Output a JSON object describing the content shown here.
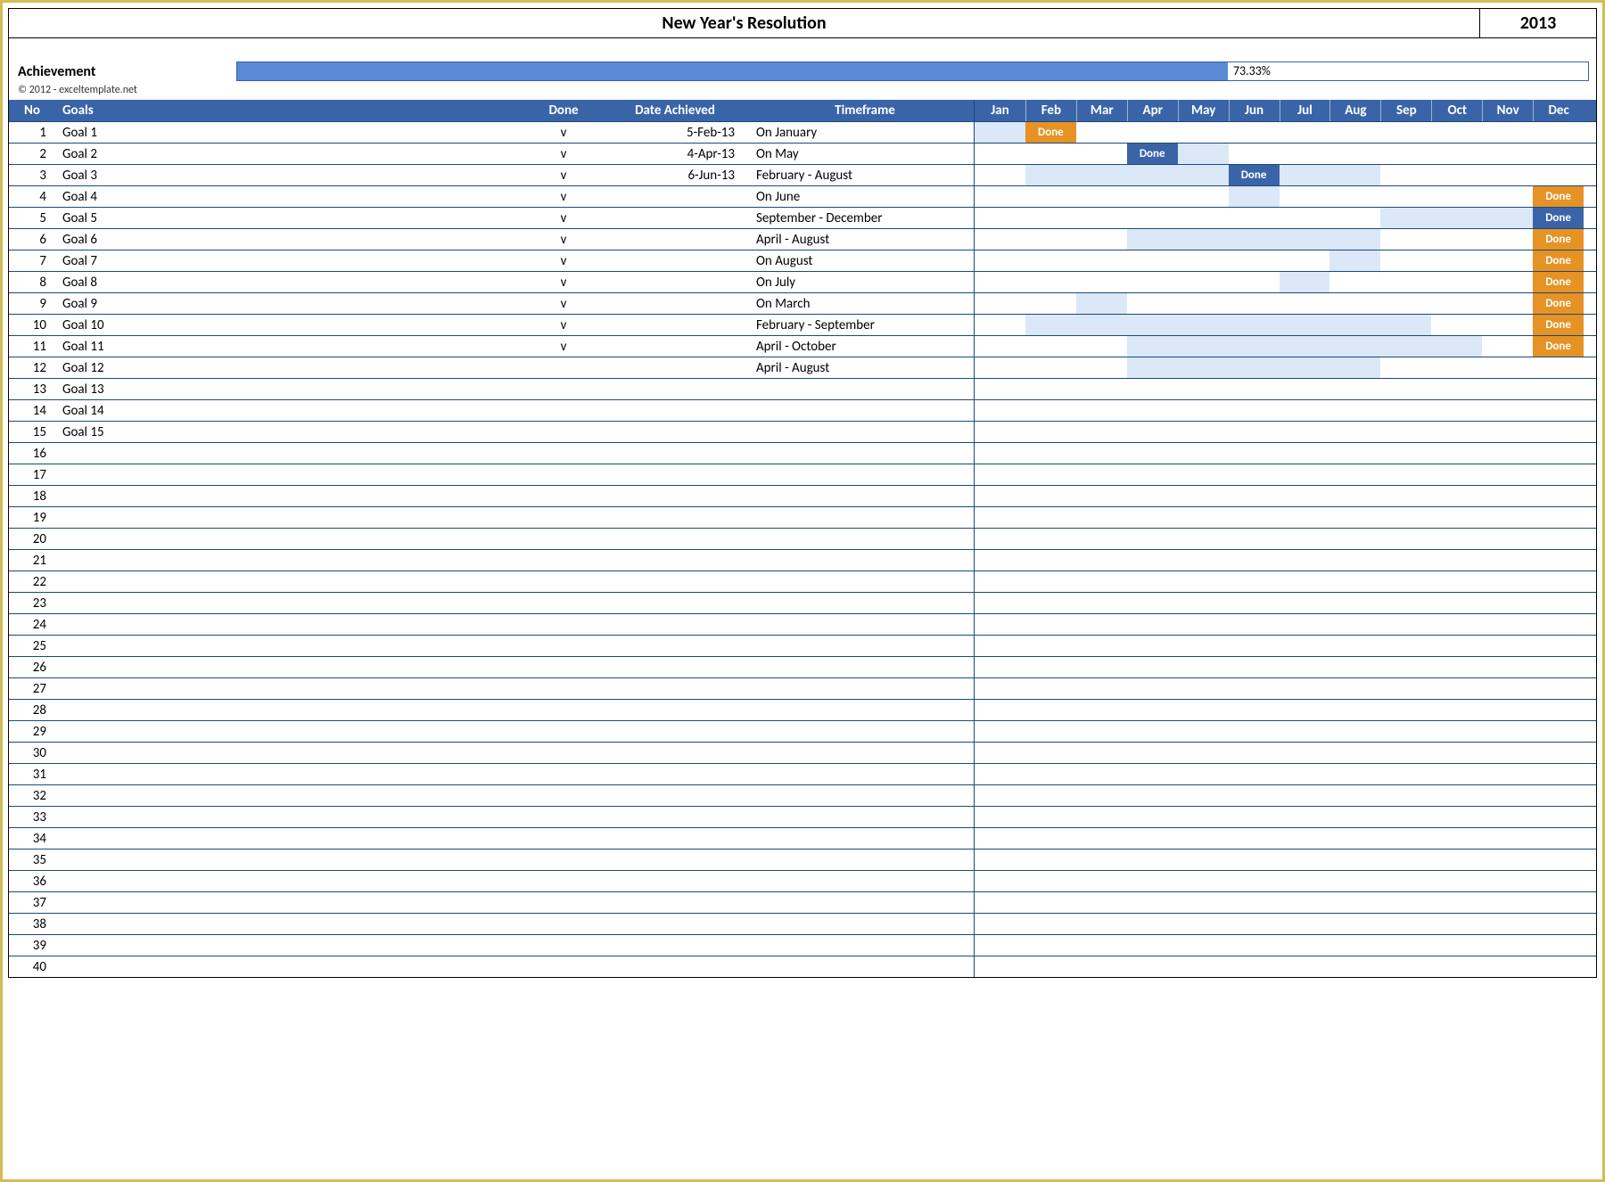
{
  "title": "New Year's Resolution",
  "year": "2013",
  "achievement": {
    "label": "Achievement",
    "percent_text": "73.33%",
    "percent": 73.33
  },
  "copyright": "© 2012 - exceltemplate.net",
  "headers": {
    "no": "No",
    "goals": "Goals",
    "done": "Done",
    "date": "Date Achieved",
    "timeframe": "Timeframe"
  },
  "months": [
    "Jan",
    "Feb",
    "Mar",
    "Apr",
    "May",
    "Jun",
    "Jul",
    "Aug",
    "Sep",
    "Oct",
    "Nov",
    "Dec"
  ],
  "done_label": "Done",
  "rows": [
    {
      "no": 1,
      "goal": "Goal 1",
      "done": "v",
      "date": "5-Feb-13",
      "timeframe": "On January",
      "bar_start": 1,
      "bar_end": 1,
      "done_month": 2,
      "done_color": "orange"
    },
    {
      "no": 2,
      "goal": "Goal 2",
      "done": "v",
      "date": "4-Apr-13",
      "timeframe": "On May",
      "bar_start": 5,
      "bar_end": 5,
      "done_month": 4,
      "done_color": "blue"
    },
    {
      "no": 3,
      "goal": "Goal 3",
      "done": "v",
      "date": "6-Jun-13",
      "timeframe": "February - August",
      "bar_start": 2,
      "bar_end": 8,
      "done_month": 6,
      "done_color": "blue"
    },
    {
      "no": 4,
      "goal": "Goal 4",
      "done": "v",
      "date": "",
      "timeframe": "On June",
      "bar_start": 6,
      "bar_end": 6,
      "done_month": 13,
      "done_color": "orange"
    },
    {
      "no": 5,
      "goal": "Goal 5",
      "done": "v",
      "date": "",
      "timeframe": "September - December",
      "bar_start": 9,
      "bar_end": 12,
      "done_month": 13,
      "done_color": "blue"
    },
    {
      "no": 6,
      "goal": "Goal 6",
      "done": "v",
      "date": "",
      "timeframe": "April - August",
      "bar_start": 4,
      "bar_end": 8,
      "done_month": 13,
      "done_color": "orange"
    },
    {
      "no": 7,
      "goal": "Goal 7",
      "done": "v",
      "date": "",
      "timeframe": "On August",
      "bar_start": 8,
      "bar_end": 8,
      "done_month": 13,
      "done_color": "orange"
    },
    {
      "no": 8,
      "goal": "Goal 8",
      "done": "v",
      "date": "",
      "timeframe": "On July",
      "bar_start": 7,
      "bar_end": 7,
      "done_month": 13,
      "done_color": "orange"
    },
    {
      "no": 9,
      "goal": "Goal 9",
      "done": "v",
      "date": "",
      "timeframe": "On March",
      "bar_start": 3,
      "bar_end": 3,
      "done_month": 13,
      "done_color": "orange"
    },
    {
      "no": 10,
      "goal": "Goal 10",
      "done": "v",
      "date": "",
      "timeframe": "February - September",
      "bar_start": 2,
      "bar_end": 9,
      "done_month": 13,
      "done_color": "orange"
    },
    {
      "no": 11,
      "goal": "Goal 11",
      "done": "v",
      "date": "",
      "timeframe": "April - October",
      "bar_start": 4,
      "bar_end": 10,
      "done_month": 13,
      "done_color": "orange"
    },
    {
      "no": 12,
      "goal": "Goal 12",
      "done": "",
      "date": "",
      "timeframe": "April - August",
      "bar_start": 4,
      "bar_end": 8,
      "done_month": 0,
      "done_color": ""
    },
    {
      "no": 13,
      "goal": "Goal 13",
      "done": "",
      "date": "",
      "timeframe": "",
      "bar_start": 0,
      "bar_end": 0,
      "done_month": 0,
      "done_color": ""
    },
    {
      "no": 14,
      "goal": "Goal 14",
      "done": "",
      "date": "",
      "timeframe": "",
      "bar_start": 0,
      "bar_end": 0,
      "done_month": 0,
      "done_color": ""
    },
    {
      "no": 15,
      "goal": "Goal 15",
      "done": "",
      "date": "",
      "timeframe": "",
      "bar_start": 0,
      "bar_end": 0,
      "done_month": 0,
      "done_color": ""
    },
    {
      "no": 16,
      "goal": "",
      "done": "",
      "date": "",
      "timeframe": "",
      "bar_start": 0,
      "bar_end": 0,
      "done_month": 0,
      "done_color": ""
    },
    {
      "no": 17,
      "goal": "",
      "done": "",
      "date": "",
      "timeframe": "",
      "bar_start": 0,
      "bar_end": 0,
      "done_month": 0,
      "done_color": ""
    },
    {
      "no": 18,
      "goal": "",
      "done": "",
      "date": "",
      "timeframe": "",
      "bar_start": 0,
      "bar_end": 0,
      "done_month": 0,
      "done_color": ""
    },
    {
      "no": 19,
      "goal": "",
      "done": "",
      "date": "",
      "timeframe": "",
      "bar_start": 0,
      "bar_end": 0,
      "done_month": 0,
      "done_color": ""
    },
    {
      "no": 20,
      "goal": "",
      "done": "",
      "date": "",
      "timeframe": "",
      "bar_start": 0,
      "bar_end": 0,
      "done_month": 0,
      "done_color": ""
    },
    {
      "no": 21,
      "goal": "",
      "done": "",
      "date": "",
      "timeframe": "",
      "bar_start": 0,
      "bar_end": 0,
      "done_month": 0,
      "done_color": ""
    },
    {
      "no": 22,
      "goal": "",
      "done": "",
      "date": "",
      "timeframe": "",
      "bar_start": 0,
      "bar_end": 0,
      "done_month": 0,
      "done_color": ""
    },
    {
      "no": 23,
      "goal": "",
      "done": "",
      "date": "",
      "timeframe": "",
      "bar_start": 0,
      "bar_end": 0,
      "done_month": 0,
      "done_color": ""
    },
    {
      "no": 24,
      "goal": "",
      "done": "",
      "date": "",
      "timeframe": "",
      "bar_start": 0,
      "bar_end": 0,
      "done_month": 0,
      "done_color": ""
    },
    {
      "no": 25,
      "goal": "",
      "done": "",
      "date": "",
      "timeframe": "",
      "bar_start": 0,
      "bar_end": 0,
      "done_month": 0,
      "done_color": ""
    },
    {
      "no": 26,
      "goal": "",
      "done": "",
      "date": "",
      "timeframe": "",
      "bar_start": 0,
      "bar_end": 0,
      "done_month": 0,
      "done_color": ""
    },
    {
      "no": 27,
      "goal": "",
      "done": "",
      "date": "",
      "timeframe": "",
      "bar_start": 0,
      "bar_end": 0,
      "done_month": 0,
      "done_color": ""
    },
    {
      "no": 28,
      "goal": "",
      "done": "",
      "date": "",
      "timeframe": "",
      "bar_start": 0,
      "bar_end": 0,
      "done_month": 0,
      "done_color": ""
    },
    {
      "no": 29,
      "goal": "",
      "done": "",
      "date": "",
      "timeframe": "",
      "bar_start": 0,
      "bar_end": 0,
      "done_month": 0,
      "done_color": ""
    },
    {
      "no": 30,
      "goal": "",
      "done": "",
      "date": "",
      "timeframe": "",
      "bar_start": 0,
      "bar_end": 0,
      "done_month": 0,
      "done_color": ""
    },
    {
      "no": 31,
      "goal": "",
      "done": "",
      "date": "",
      "timeframe": "",
      "bar_start": 0,
      "bar_end": 0,
      "done_month": 0,
      "done_color": ""
    },
    {
      "no": 32,
      "goal": "",
      "done": "",
      "date": "",
      "timeframe": "",
      "bar_start": 0,
      "bar_end": 0,
      "done_month": 0,
      "done_color": ""
    },
    {
      "no": 33,
      "goal": "",
      "done": "",
      "date": "",
      "timeframe": "",
      "bar_start": 0,
      "bar_end": 0,
      "done_month": 0,
      "done_color": ""
    },
    {
      "no": 34,
      "goal": "",
      "done": "",
      "date": "",
      "timeframe": "",
      "bar_start": 0,
      "bar_end": 0,
      "done_month": 0,
      "done_color": ""
    },
    {
      "no": 35,
      "goal": "",
      "done": "",
      "date": "",
      "timeframe": "",
      "bar_start": 0,
      "bar_end": 0,
      "done_month": 0,
      "done_color": ""
    },
    {
      "no": 36,
      "goal": "",
      "done": "",
      "date": "",
      "timeframe": "",
      "bar_start": 0,
      "bar_end": 0,
      "done_month": 0,
      "done_color": ""
    },
    {
      "no": 37,
      "goal": "",
      "done": "",
      "date": "",
      "timeframe": "",
      "bar_start": 0,
      "bar_end": 0,
      "done_month": 0,
      "done_color": ""
    },
    {
      "no": 38,
      "goal": "",
      "done": "",
      "date": "",
      "timeframe": "",
      "bar_start": 0,
      "bar_end": 0,
      "done_month": 0,
      "done_color": ""
    },
    {
      "no": 39,
      "goal": "",
      "done": "",
      "date": "",
      "timeframe": "",
      "bar_start": 0,
      "bar_end": 0,
      "done_month": 0,
      "done_color": ""
    },
    {
      "no": 40,
      "goal": "",
      "done": "",
      "date": "",
      "timeframe": "",
      "bar_start": 0,
      "bar_end": 0,
      "done_month": 0,
      "done_color": ""
    }
  ]
}
